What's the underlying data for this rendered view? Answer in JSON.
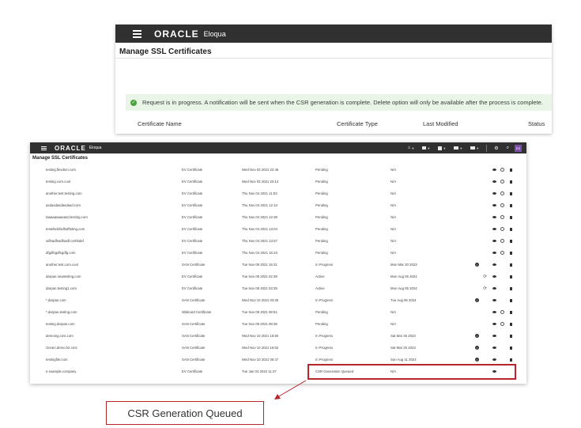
{
  "app": {
    "brand": "ORACLE",
    "product": "Eloqua"
  },
  "top_panel": {
    "page_title": "Manage SSL Certificates",
    "notice": "Request is in progress. A notification will be sent when the CSR generation is complete. Delete option will only be available after the process is complete.",
    "columns": {
      "name": "Certificate Name",
      "type": "Certificate Type",
      "modified": "Last Modified",
      "status": "Status"
    }
  },
  "main_panel": {
    "page_title": "Manage SSL Certificates",
    "nav": {
      "avatar": "ES"
    },
    "rows": [
      {
        "name": "testing.flexdsm.com",
        "type": "EV Certificate",
        "date": "Wed Nov 03 2021 22:46",
        "status": "Pending",
        "req": "N/A",
        "icons": [
          "eye",
          "dl",
          "trash"
        ]
      },
      {
        "name": "testing.com.cool",
        "type": "EV Certificate",
        "date": "Wed Nov 03 2021 23:14",
        "status": "Pending",
        "req": "N/A",
        "icons": [
          "eye",
          "dl",
          "trash"
        ]
      },
      {
        "name": "another.test.testing.com",
        "type": "EV Certificate",
        "date": "Thu Nov 04 2021 11:53",
        "status": "Pending",
        "req": "N/A",
        "icons": [
          "eye",
          "dl",
          "trash"
        ]
      },
      {
        "name": "asdasdasdasdasd.com",
        "type": "EV Certificate",
        "date": "Thu Nov 04 2021 12:13",
        "status": "Pending",
        "req": "N/A",
        "icons": [
          "eye",
          "dl",
          "trash"
        ]
      },
      {
        "name": "taaaaaaaaaasd.testing.com",
        "type": "EV Certificate",
        "date": "Thu Nov 04 2021 12:38",
        "status": "Pending",
        "req": "N/A",
        "icons": [
          "eye",
          "dl",
          "trash"
        ]
      },
      {
        "name": "testsfsdsfsdfsdftsting.com",
        "type": "EV Certificate",
        "date": "Thu Nov 04 2021 13:04",
        "status": "Pending",
        "req": "N/A",
        "icons": [
          "eye",
          "dl",
          "trash"
        ]
      },
      {
        "name": "sdfsadfsadfsadf.certfsdaf",
        "type": "EV Certificate",
        "date": "Thu Nov 04 2021 13:57",
        "status": "Pending",
        "req": "N/A",
        "icons": [
          "eye",
          "dl",
          "trash"
        ]
      },
      {
        "name": "dfgdfsgdfsgdfg.com",
        "type": "EV Certificate",
        "date": "Thu Nov 04 2021 16:23",
        "status": "Pending",
        "req": "N/A",
        "icons": [
          "eye",
          "dl",
          "trash"
        ]
      },
      {
        "name": "another.test.com.cool",
        "type": "SAN Certificate",
        "date": "Tue Nov 09 2021 15:31",
        "status": "In Progress",
        "req": "Mon Mar 20 2023",
        "icons": [
          "check",
          "eye",
          "trash"
        ]
      },
      {
        "name": "darpan.newtesting.com",
        "type": "EV Certificate",
        "date": "Tue Nov 09 2021 02:39",
        "status": "Active",
        "req": "Mon Aug 05 2024",
        "icons": [
          "cycle",
          "eye",
          "trash"
        ]
      },
      {
        "name": "darpan.testing1.com",
        "type": "EV Certificate",
        "date": "Tue Nov 09 2021 03:39",
        "status": "Active",
        "req": "Mon Aug 05 2024",
        "icons": [
          "cycle",
          "eye",
          "trash"
        ]
      },
      {
        "name": "*.darpan.com",
        "type": "SAN Certificate",
        "date": "Wed Nov 10 2021 03:25",
        "status": "In Progress",
        "req": "Tue Aug 06 2024",
        "icons": [
          "check",
          "eye",
          "trash"
        ]
      },
      {
        "name": "*.darpan.testing.com",
        "type": "Wildcard Certificate",
        "date": "Tue Nov 09 2021 08:51",
        "status": "Pending",
        "req": "N/A",
        "icons": [
          "eye",
          "dl",
          "trash"
        ]
      },
      {
        "name": "testing.darpan.com",
        "type": "SAN Certificate",
        "date": "Tue Nov 09 2021 08:38",
        "status": "Pending",
        "req": "N/A",
        "icons": [
          "eye",
          "dl",
          "trash"
        ]
      },
      {
        "name": "demoing.cms.com",
        "type": "SAN Certificate",
        "date": "Wed Nov 10 2021 15:50",
        "status": "In Progress",
        "req": "Sat Mar 25 2023",
        "icons": [
          "check",
          "eye",
          "trash"
        ]
      },
      {
        "name": "clonen.demo.for.cms",
        "type": "SAN Certificate",
        "date": "Wed Nov 10 2021 16:52",
        "status": "In Progress",
        "req": "Sat Mar 25 2023",
        "icons": [
          "check",
          "eye",
          "trash"
        ]
      },
      {
        "name": "testingfile.com",
        "type": "SAN Certificate",
        "date": "Wed Nov 10 2021 06:47",
        "status": "In Progress",
        "req": "Sun Aug 11 2024",
        "icons": [
          "check",
          "eye",
          "trash"
        ]
      },
      {
        "name": "e.example.company",
        "type": "EV Certificate",
        "date": "Tue Jan 04 2022 11:37",
        "status": "CSR Generation Queued",
        "req": "N/A",
        "icons": [
          "eye"
        ]
      }
    ]
  },
  "callout": {
    "label": "CSR Generation Queued"
  },
  "colors": {
    "topbar": "#313030",
    "notice_bg": "#e9f6e7",
    "success": "#4aa23f",
    "highlight": "#b7262a",
    "avatar": "#7b4ea8"
  }
}
